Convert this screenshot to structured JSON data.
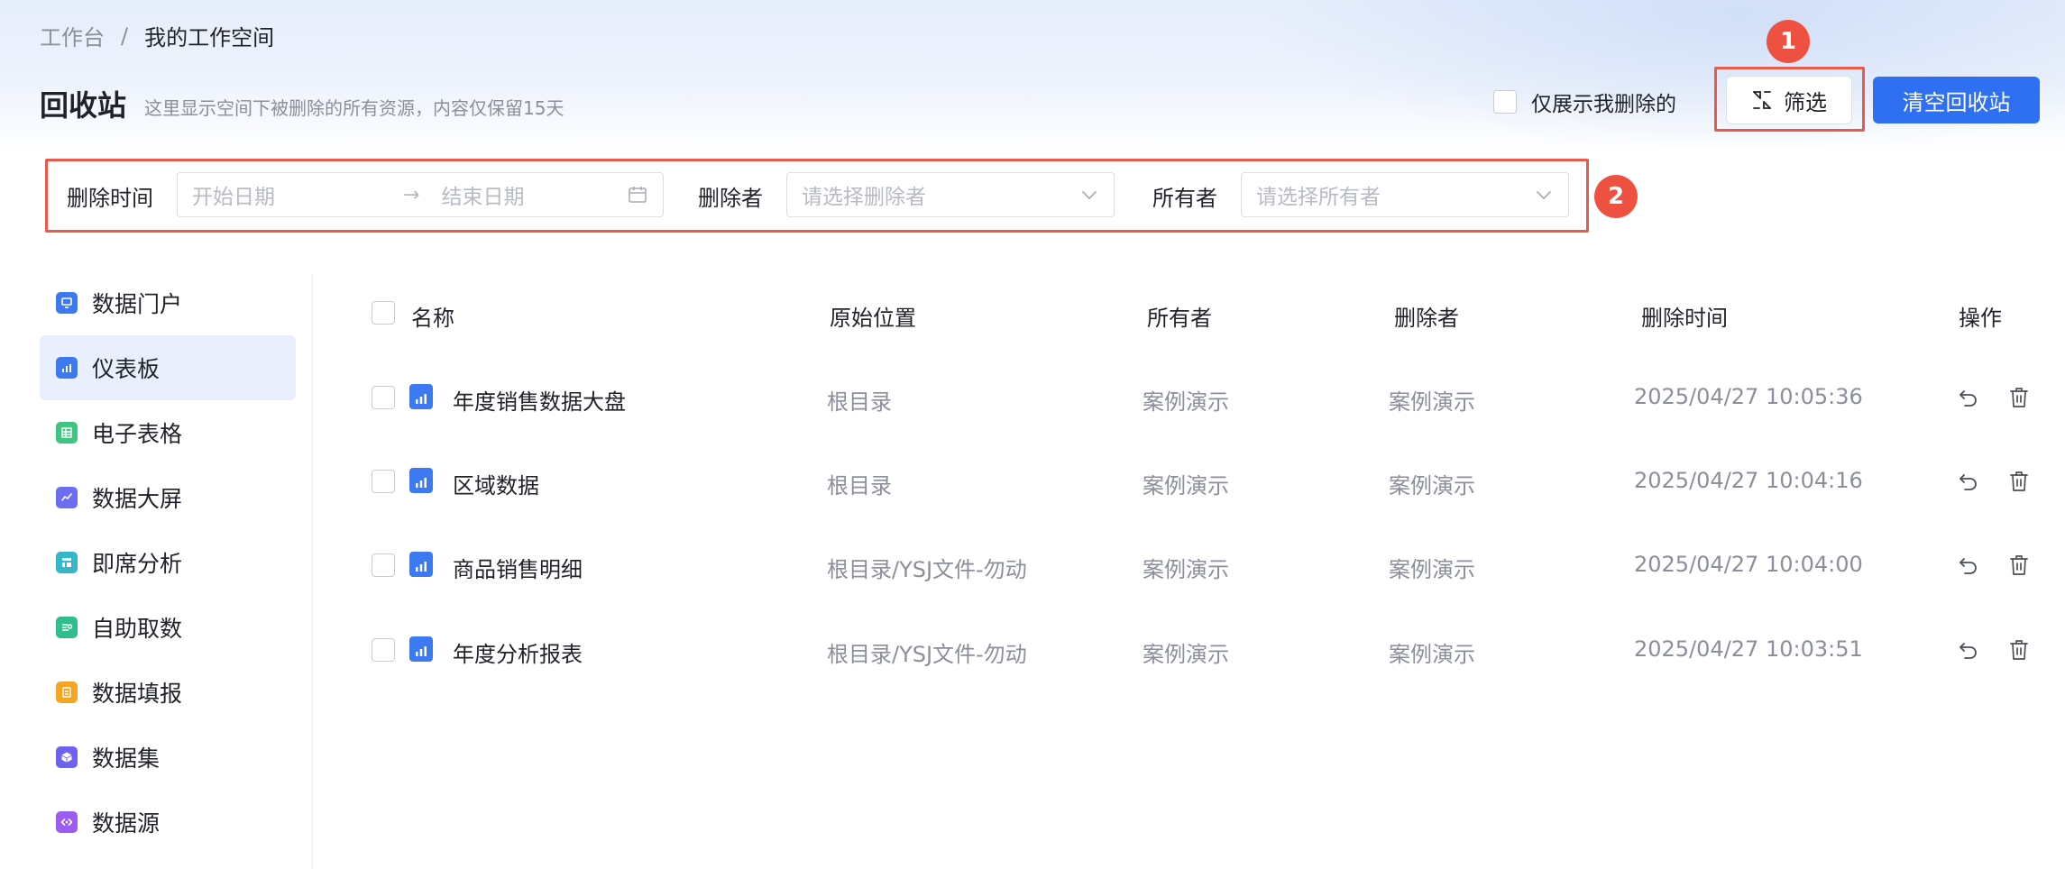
{
  "breadcrumb": {
    "root": "工作台",
    "separator": "/",
    "current": "我的工作空间"
  },
  "page": {
    "title": "回收站",
    "description": "这里显示空间下被删除的所有资源，内容仅保留15天"
  },
  "header": {
    "only_mine_label": "仅展示我删除的",
    "filter_label": "筛选",
    "clear_label": "清空回收站"
  },
  "annotations": {
    "badge1": "1",
    "badge2": "2"
  },
  "filters": {
    "delete_time_label": "删除时间",
    "start_placeholder": "开始日期",
    "end_placeholder": "结束日期",
    "deleter_label": "删除者",
    "deleter_placeholder": "请选择删除者",
    "owner_label": "所有者",
    "owner_placeholder": "请选择所有者"
  },
  "sidebar": {
    "items": [
      {
        "label": "数据门户",
        "color": "#3d7af2",
        "icon": "portal-icon"
      },
      {
        "label": "仪表板",
        "color": "#3d7af2",
        "icon": "dashboard-icon",
        "active": true
      },
      {
        "label": "电子表格",
        "color": "#3fc481",
        "icon": "spreadsheet-icon"
      },
      {
        "label": "数据大屏",
        "color": "#6b6ef2",
        "icon": "screen-icon"
      },
      {
        "label": "即席分析",
        "color": "#35b7c9",
        "icon": "adhoc-analysis-icon"
      },
      {
        "label": "自助取数",
        "color": "#2fbf8c",
        "icon": "self-service-icon"
      },
      {
        "label": "数据填报",
        "color": "#f5a524",
        "icon": "data-entry-icon"
      },
      {
        "label": "数据集",
        "color": "#6b63f0",
        "icon": "dataset-icon"
      },
      {
        "label": "数据源",
        "color": "#9b5cf0",
        "icon": "datasource-icon"
      }
    ]
  },
  "table": {
    "columns": {
      "name": "名称",
      "location": "原始位置",
      "owner": "所有者",
      "deleter": "删除者",
      "deleted_at": "删除时间",
      "actions": "操作"
    },
    "rows": [
      {
        "name": "年度销售数据大盘",
        "location": "根目录",
        "owner": "案例演示",
        "deleter": "案例演示",
        "deleted_at": "2025/04/27 10:05:36"
      },
      {
        "name": "区域数据",
        "location": "根目录",
        "owner": "案例演示",
        "deleter": "案例演示",
        "deleted_at": "2025/04/27 10:04:16"
      },
      {
        "name": "商品销售明细",
        "location": "根目录/YSJ文件-勿动",
        "owner": "案例演示",
        "deleter": "案例演示",
        "deleted_at": "2025/04/27 10:04:00"
      },
      {
        "name": "年度分析报表",
        "location": "根目录/YSJ文件-勿动",
        "owner": "案例演示",
        "deleter": "案例演示",
        "deleted_at": "2025/04/27 10:03:51"
      }
    ]
  },
  "colors": {
    "primary": "#2f6ff2",
    "annotation": "#ea5a4a",
    "muted_text": "#8a8f99"
  }
}
